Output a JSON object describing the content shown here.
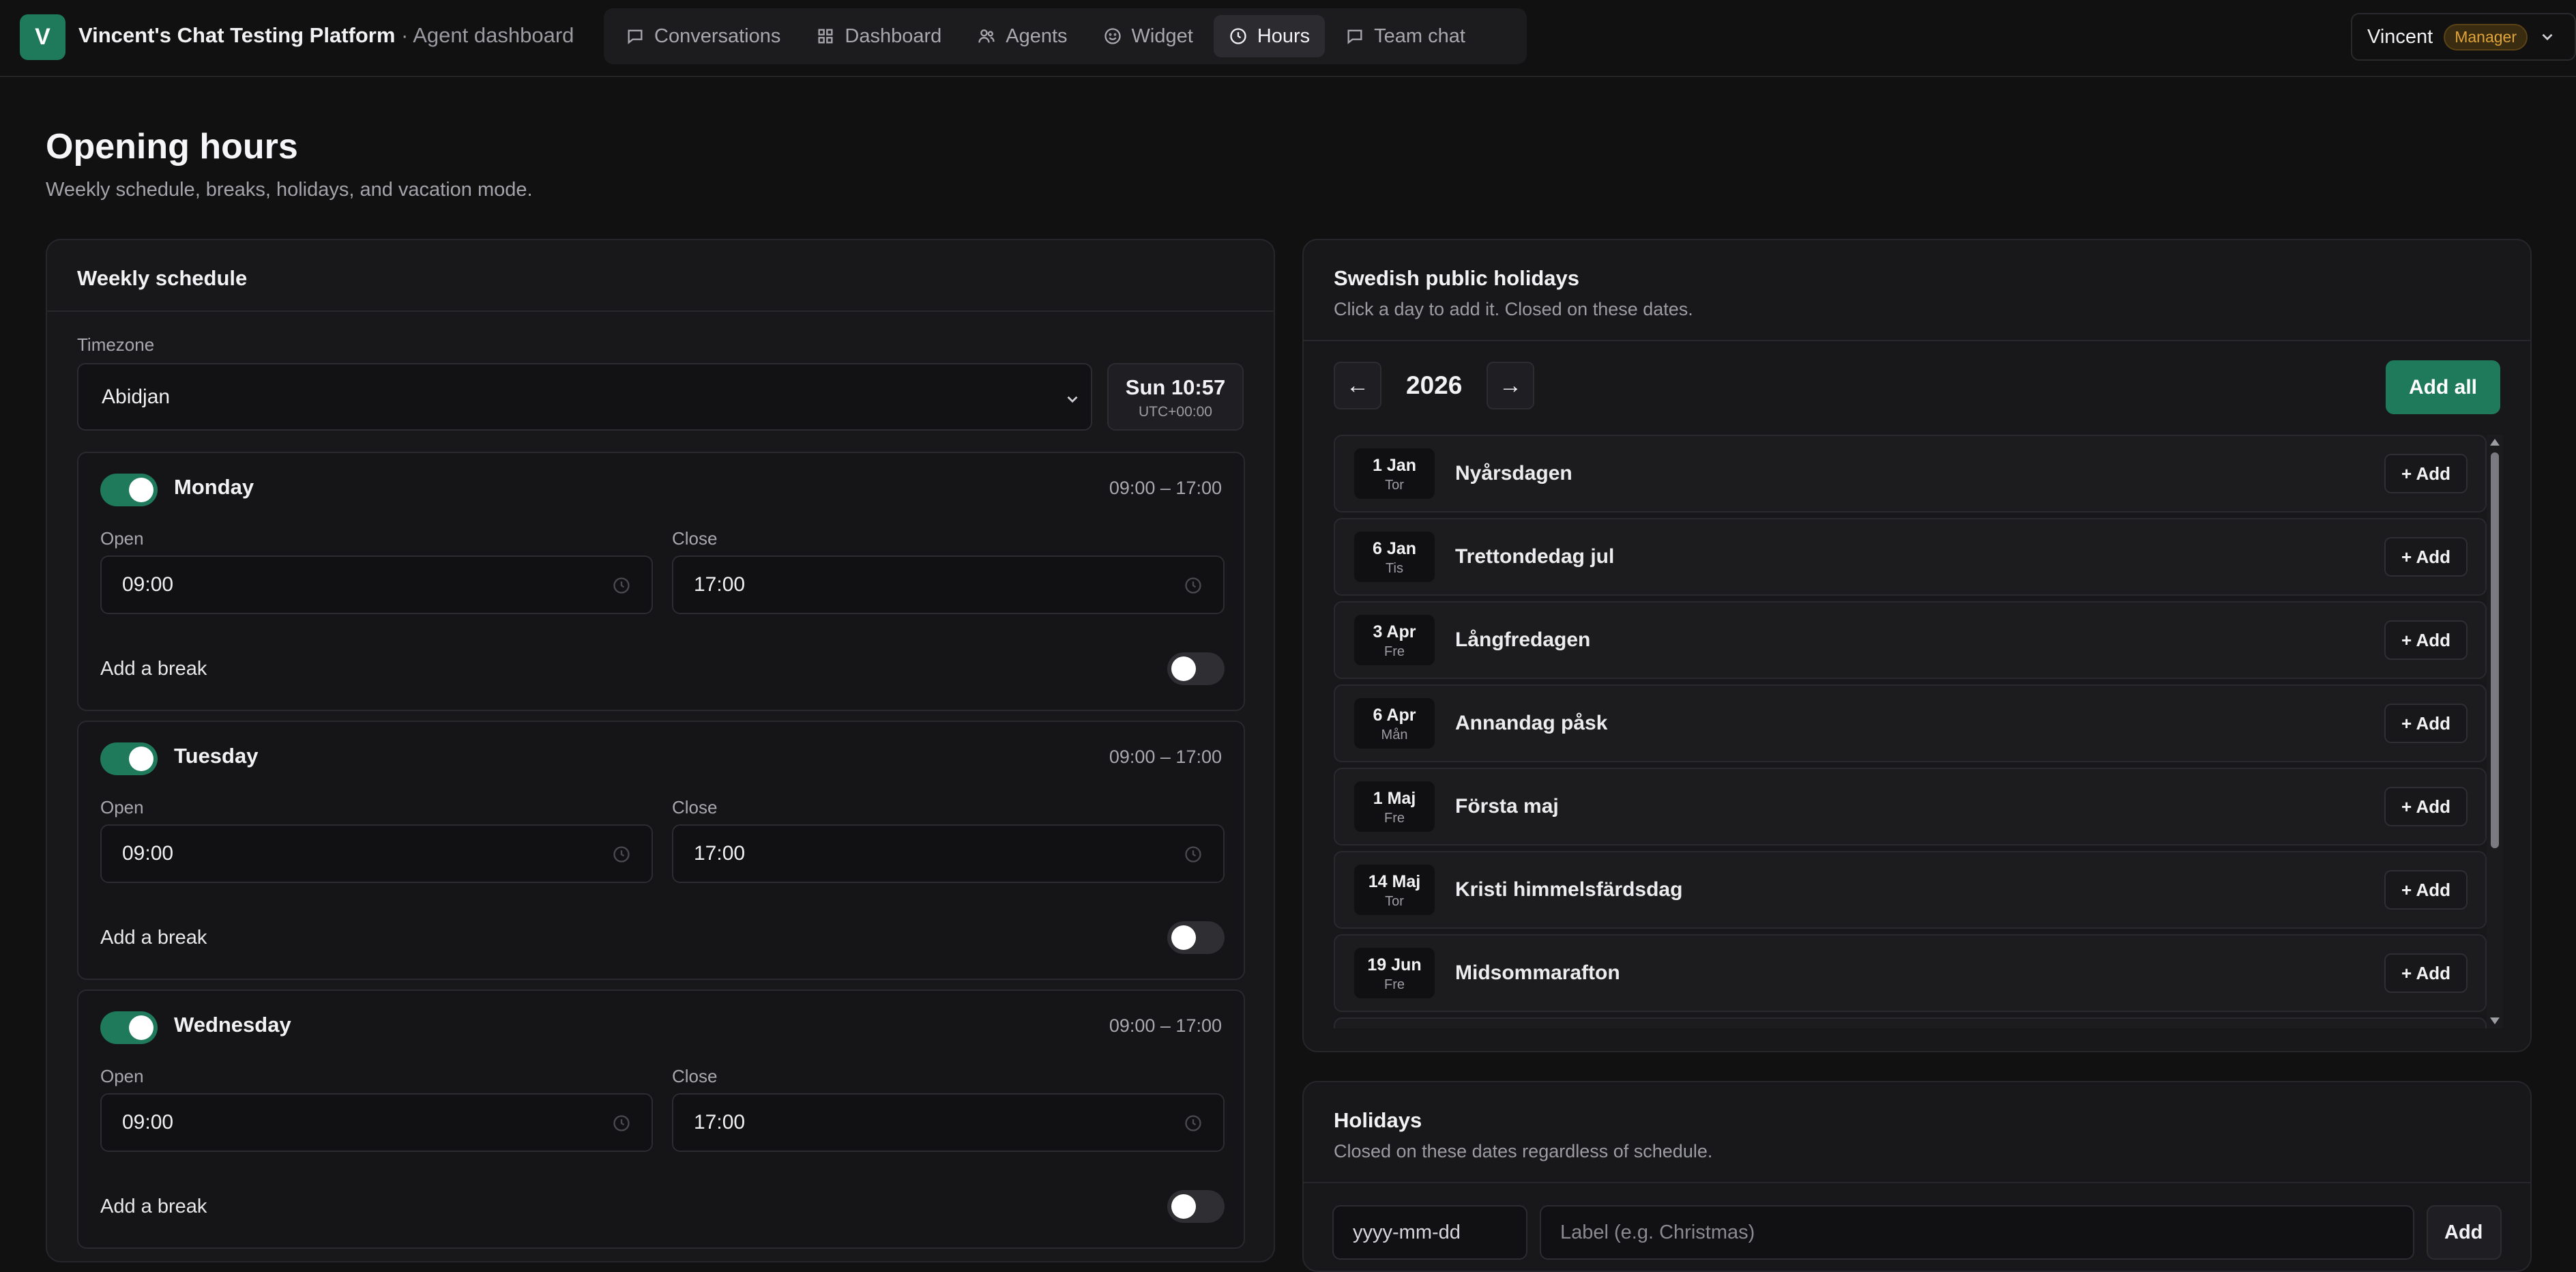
{
  "header": {
    "logo_letter": "V",
    "app_name": "Vincent's Chat Testing Platform",
    "app_section": " · Agent dashboard",
    "nav": [
      {
        "label": "Conversations",
        "icon": "chat-bubble-icon",
        "active": false
      },
      {
        "label": "Dashboard",
        "icon": "grid-icon",
        "active": false
      },
      {
        "label": "Agents",
        "icon": "users-icon",
        "active": false
      },
      {
        "label": "Widget",
        "icon": "smiley-icon",
        "active": false
      },
      {
        "label": "Hours",
        "icon": "clock-icon",
        "active": true
      },
      {
        "label": "Team chat",
        "icon": "chat-bubble-icon",
        "active": false
      }
    ],
    "user_name": "Vincent",
    "user_role": "Manager"
  },
  "page": {
    "title": "Opening hours",
    "subtitle": "Weekly schedule, breaks, holidays, and vacation mode."
  },
  "weekly": {
    "title": "Weekly schedule",
    "timezone_label": "Timezone",
    "timezone_value": "Abidjan",
    "clock_time": "Sun 10:57",
    "clock_zone": "UTC+00:00",
    "open_label": "Open",
    "close_label": "Close",
    "break_label": "Add a break",
    "days": [
      {
        "name": "Monday",
        "range": "09:00 – 17:00",
        "open": "09:00",
        "close": "17:00",
        "enabled": true,
        "break_enabled": false
      },
      {
        "name": "Tuesday",
        "range": "09:00 – 17:00",
        "open": "09:00",
        "close": "17:00",
        "enabled": true,
        "break_enabled": false
      },
      {
        "name": "Wednesday",
        "range": "09:00 – 17:00",
        "open": "09:00",
        "close": "17:00",
        "enabled": true,
        "break_enabled": false
      }
    ]
  },
  "public_holidays": {
    "title": "Swedish public holidays",
    "description": "Click a day to add it. Closed on these dates.",
    "prev_label": "←",
    "next_label": "→",
    "year": "2026",
    "add_all_label": "Add all",
    "add_label": "+ Add",
    "items": [
      {
        "date": "1 Jan",
        "weekday": "Tor",
        "name": "Nyårsdagen"
      },
      {
        "date": "6 Jan",
        "weekday": "Tis",
        "name": "Trettondedag jul"
      },
      {
        "date": "3 Apr",
        "weekday": "Fre",
        "name": "Långfredagen"
      },
      {
        "date": "6 Apr",
        "weekday": "Mån",
        "name": "Annandag påsk"
      },
      {
        "date": "1 Maj",
        "weekday": "Fre",
        "name": "Första maj"
      },
      {
        "date": "14 Maj",
        "weekday": "Tor",
        "name": "Kristi himmelsfärdsdag"
      },
      {
        "date": "19 Jun",
        "weekday": "Fre",
        "name": "Midsommarafton"
      }
    ]
  },
  "holidays": {
    "title": "Holidays",
    "description": "Closed on these dates regardless of schedule.",
    "date_placeholder": "yyyy-mm-dd",
    "label_placeholder": "Label (e.g. Christmas)",
    "add_label": "Add"
  },
  "colors": {
    "accent": "#1f7a5c",
    "background": "#111112",
    "card": "#18181b",
    "manager_badge": "#e0a43a"
  }
}
